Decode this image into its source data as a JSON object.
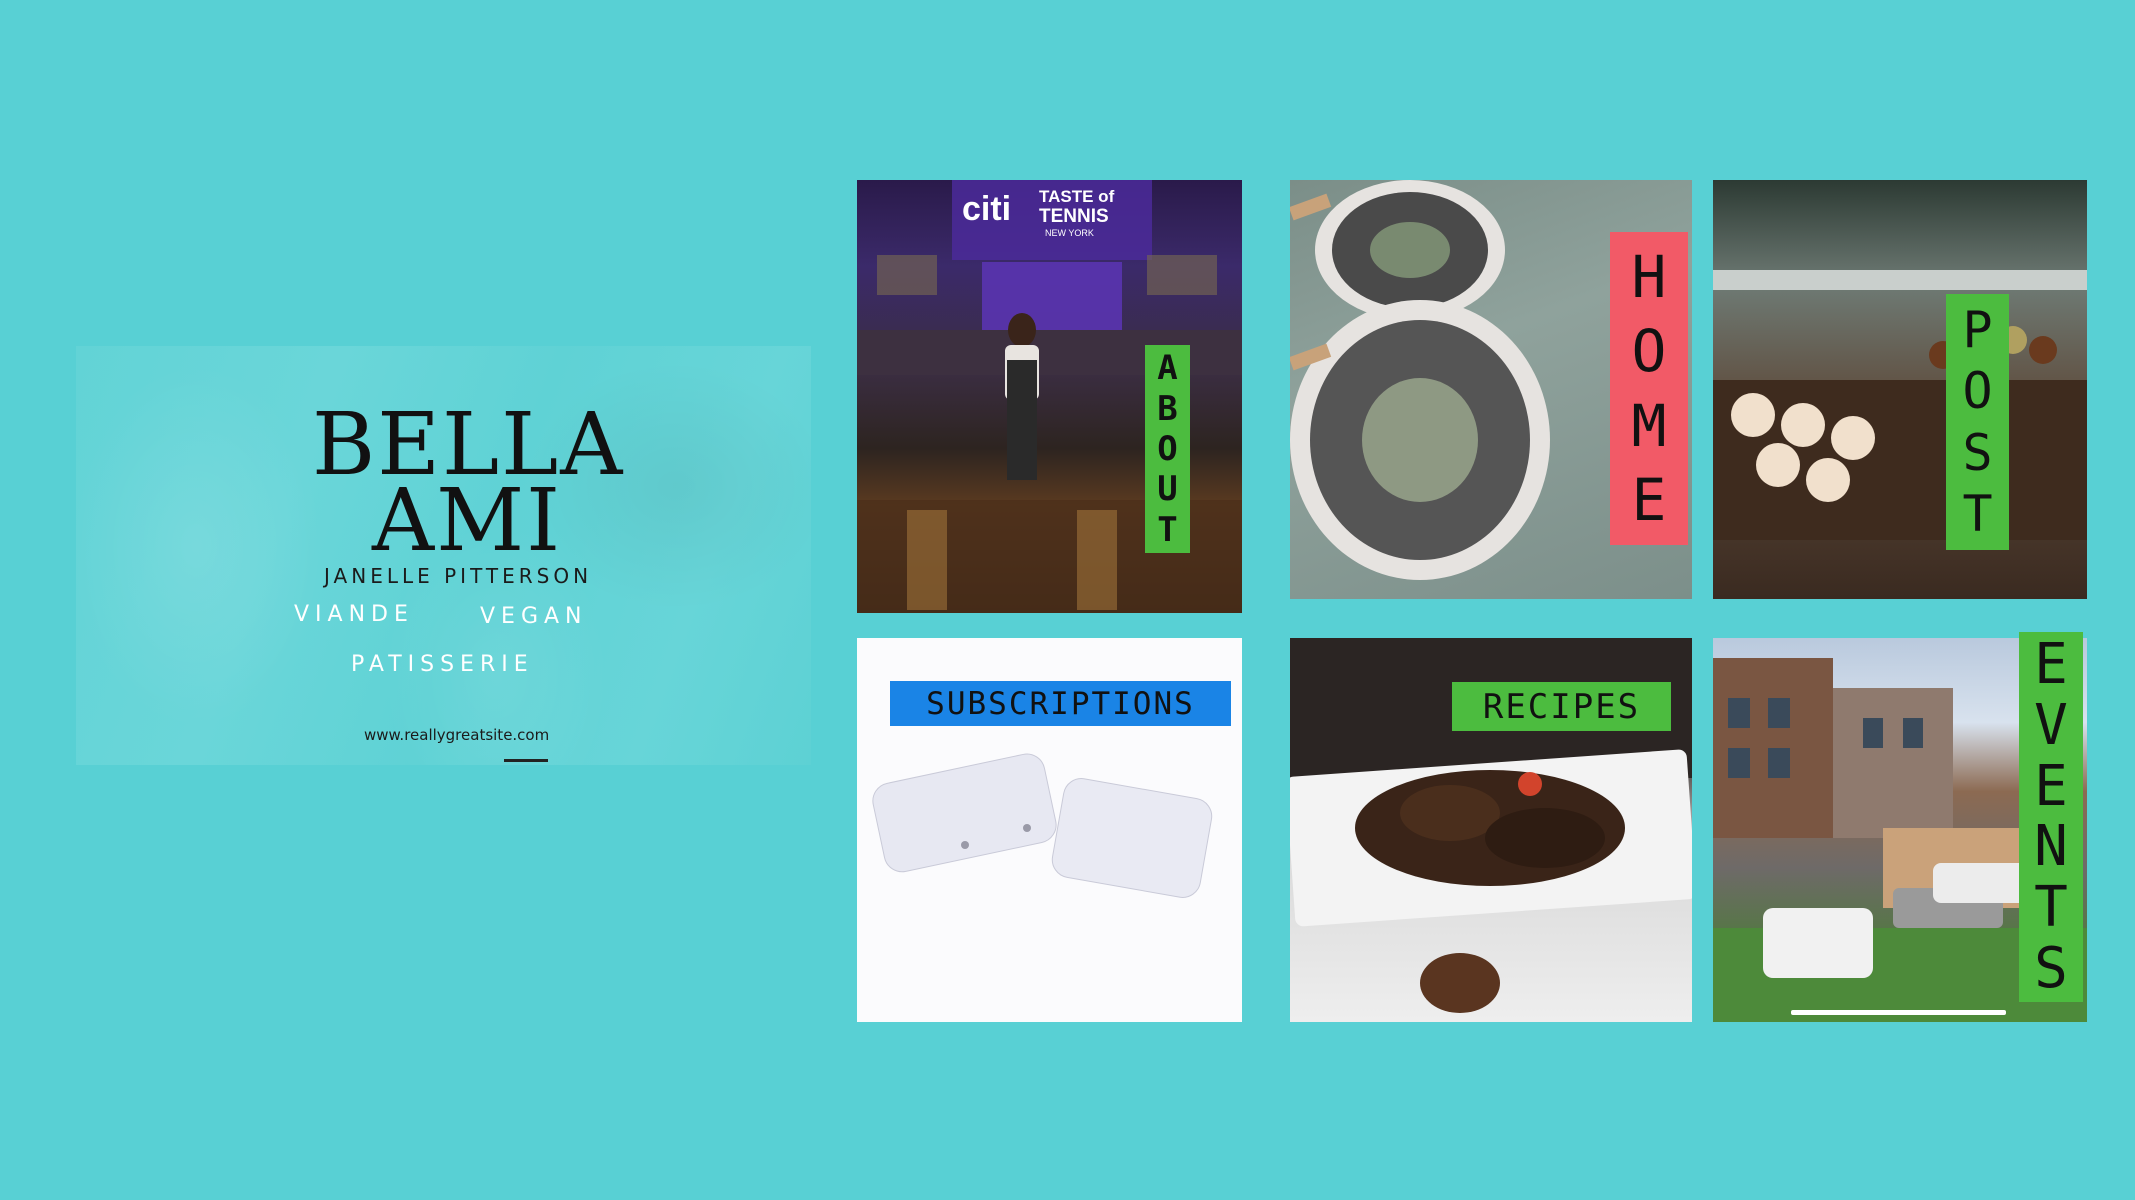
{
  "brand": {
    "logo_line_1": "BELLA",
    "logo_line_2": "AMI",
    "owner_name": "JANELLE PITTERSON",
    "categories": [
      "VIANDE",
      "VEGAN",
      "PATISSERIE"
    ],
    "website": "www.reallygreatsite.com"
  },
  "tiles": {
    "about": {
      "label_letters": [
        "A",
        "B",
        "O",
        "U",
        "T"
      ],
      "label_color": "#4cbc3f"
    },
    "home": {
      "label_letters": [
        "H",
        "O",
        "M",
        "E"
      ],
      "label_color": "#f25a67"
    },
    "post": {
      "label_letters": [
        "P",
        "O",
        "S",
        "T"
      ],
      "label_color": "#4cbc3f"
    },
    "subscriptions": {
      "label": "SUBSCRIPTIONS",
      "label_color": "#1a84e6"
    },
    "recipes": {
      "label": "RECIPES",
      "label_color": "#4cbc3f"
    },
    "events": {
      "label_letters": [
        "E",
        "V",
        "E",
        "N",
        "T",
        "S"
      ],
      "label_color": "#4cbc3f"
    }
  },
  "about_photo_signage": {
    "sponsor": "citi",
    "event_line_1": "TASTE of",
    "event_line_2": "TENNIS",
    "event_line_3": "NEW YORK"
  },
  "colors": {
    "background": "#58d0d4",
    "accent_green": "#4cbc3f",
    "accent_red": "#f25a67",
    "accent_blue": "#1a84e6"
  }
}
